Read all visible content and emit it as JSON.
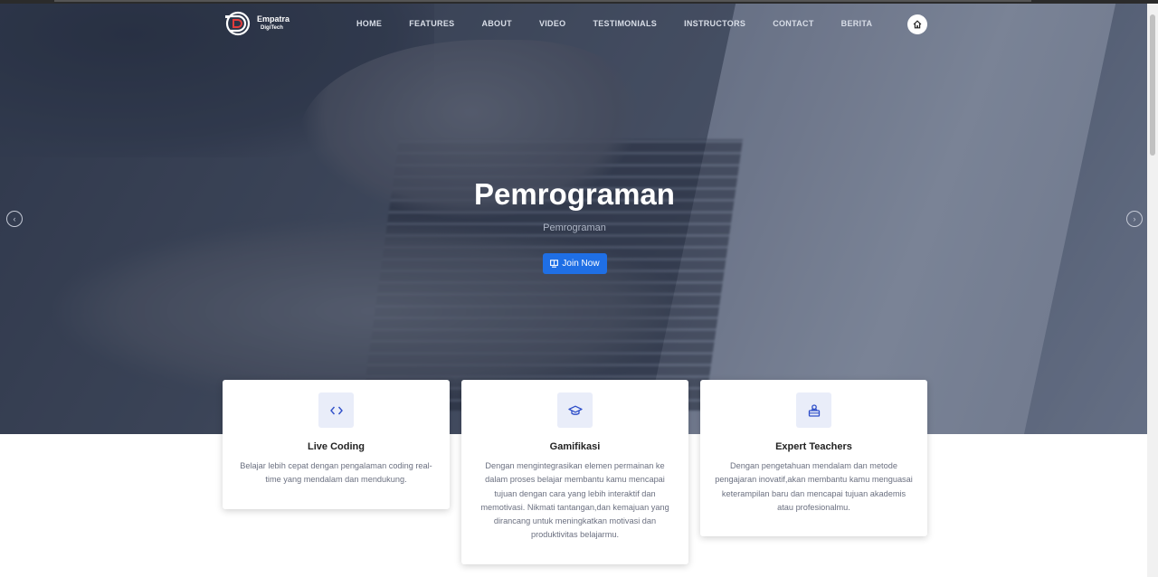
{
  "brand": {
    "name": "Empatra",
    "tagline": "DigiTech",
    "logo_icon": "empatra-logo-icon"
  },
  "nav": {
    "items": [
      "HOME",
      "FEATURES",
      "ABOUT",
      "VIDEO",
      "TESTIMONIALS",
      "INSTRUCTORS",
      "CONTACT",
      "BERITA"
    ],
    "home_icon": "home-icon"
  },
  "hero": {
    "title": "Pemrograman",
    "subtitle": "Pemrograman",
    "cta_label": "Join Now",
    "cta_icon": "book-icon",
    "prev_icon": "chevron-left-icon",
    "next_icon": "chevron-right-icon"
  },
  "features": [
    {
      "title": "Live Coding",
      "icon": "code-icon",
      "description": "Belajar lebih cepat dengan pengalaman coding real-time yang mendalam dan mendukung."
    },
    {
      "title": "Gamifikasi",
      "icon": "graduation-cap-icon",
      "description": "Dengan mengintegrasikan elemen permainan ke dalam proses belajar membantu kamu mencapai tujuan dengan cara yang lebih interaktif dan memotivasi. Nikmati tantangan,dan kemajuan yang dirancang untuk meningkatkan motivasi dan produktivitas belajarmu."
    },
    {
      "title": "Expert Teachers",
      "icon": "teacher-icon",
      "description": "Dengan pengetahuan mendalam dan metode pengajaran inovatif,akan membantu kamu menguasai keterampilan baru dan mencapai tujuan akademis atau profesionalmu."
    }
  ],
  "colors": {
    "primary": "#1f6fe5",
    "icon_bg": "#e9edf9",
    "icon_fg": "#2f4fc9"
  }
}
